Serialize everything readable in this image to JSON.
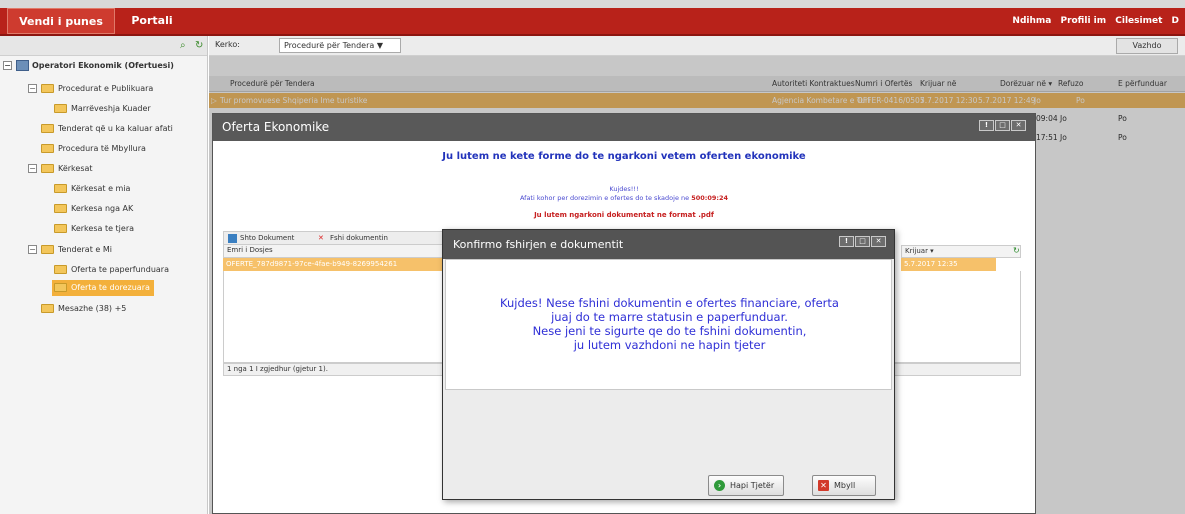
{
  "topbar": {
    "tabs": [
      {
        "label": "Vendi i punes"
      },
      {
        "label": "Portali"
      }
    ],
    "nav": [
      "Ndihma",
      "Profili im",
      "Cilesimet",
      "D"
    ]
  },
  "sidebar": {
    "root": "Operatori Ekonomik (Ofertuesi)",
    "items": [
      {
        "label": "Procedurat e Publikuara"
      },
      {
        "label": "Marrëveshja Kuader"
      },
      {
        "label": "Tenderat që u ka kaluar afati"
      },
      {
        "label": "Procedura të Mbyllura"
      },
      {
        "label": "Kërkesat"
      },
      {
        "label": "Kërkesat e mia"
      },
      {
        "label": "Kerkesa nga AK"
      },
      {
        "label": "Kerkesa te tjera"
      },
      {
        "label": "Tenderat e Mi"
      },
      {
        "label": "Oferta te paperfunduara"
      },
      {
        "label": "Oferta te dorezuara"
      },
      {
        "label": "Mesazhe (38) +5"
      }
    ]
  },
  "search": {
    "label": "Kerko:",
    "selected": "Procedurë për Tendera ▼",
    "button": "Vazhdo"
  },
  "grid": {
    "columns": [
      "Procedurë për Tendera",
      "Autoriteti Kontraktues",
      "Numri i Ofertës",
      "Krijuar në",
      "Dorëzuar në ▾",
      "Refuzo",
      "E përfunduar"
    ],
    "rows": [
      {
        "name": "Tur promovuese Shqiperia Ime turistike",
        "ak": "Agjencia Kombetare e Turi",
        "num": "OFFER-0416/0507",
        "krijuar": "5.7.2017 12:30",
        "dorezuar": "5.7.2017 12:49",
        "refuzo": "Jo",
        "perf": "Po"
      },
      {
        "dorezuar": "09:04",
        "refuzo": "Jo",
        "perf": "Po"
      },
      {
        "dorezuar": "17:51",
        "refuzo": "Jo",
        "perf": "Po"
      }
    ]
  },
  "oferta_window": {
    "title": "Oferta Ekonomike",
    "heading": "Ju lutem ne kete forme do te ngarkoni vetem oferten ekonomike",
    "kujdes": "Kujdes!!!",
    "afati_text": "Afati kohor per dorezimin e ofertes do te skadoje ne",
    "afati_value": "500:09:24",
    "red_note": "Ju lutem ngarkoni dokumentat ne format .pdf",
    "toolbar": {
      "add": "Shto Dokument",
      "delete": "Fshi dokumentin"
    },
    "doc_header": "Emri i Dosjes",
    "doc_name": "OFERTE_787d9871-97ce-4fae-b949-8269954261",
    "krijuar_header": "Krijuar ▾",
    "doc_date": "5.7.2017 12:35",
    "pager": "1 nga 1 I zgjedhur (gjetur 1)."
  },
  "confirm_dialog": {
    "title": "Konfirmo fshirjen e dokumentit",
    "message": [
      "Kujdes! Nese fshini dokumentin e ofertes financiare, oferta",
      "juaj do te marre statusin e paperfunduar.",
      "Nese jeni te sigurte qe do te fshini dokumentin,",
      "ju lutem vazhdoni ne hapin tjeter"
    ],
    "next_button": "Hapi Tjetër",
    "close_button": "Mbyll"
  },
  "colors": {
    "topbar": "#b8221a",
    "selection": "#f6c16a",
    "dialog_text": "#2f2fd6"
  }
}
